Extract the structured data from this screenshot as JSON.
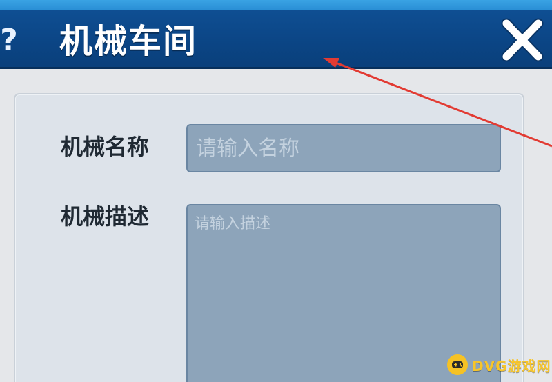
{
  "dialog": {
    "help_symbol": "?",
    "title": "机械车间",
    "close_symbol": "✕"
  },
  "form": {
    "name_label": "机械名称",
    "name_placeholder": "请输入名称",
    "description_label": "机械描述",
    "description_placeholder": "请输入描述"
  },
  "watermark": {
    "text": "DVG游戏网"
  },
  "colors": {
    "titlebar": "#0b4585",
    "top_strip": "#2a8fd6",
    "panel": "#dde3ea",
    "input_fill": "#8da4ba",
    "annotation_arrow": "#e23b33",
    "watermark": "#f7c52a"
  }
}
